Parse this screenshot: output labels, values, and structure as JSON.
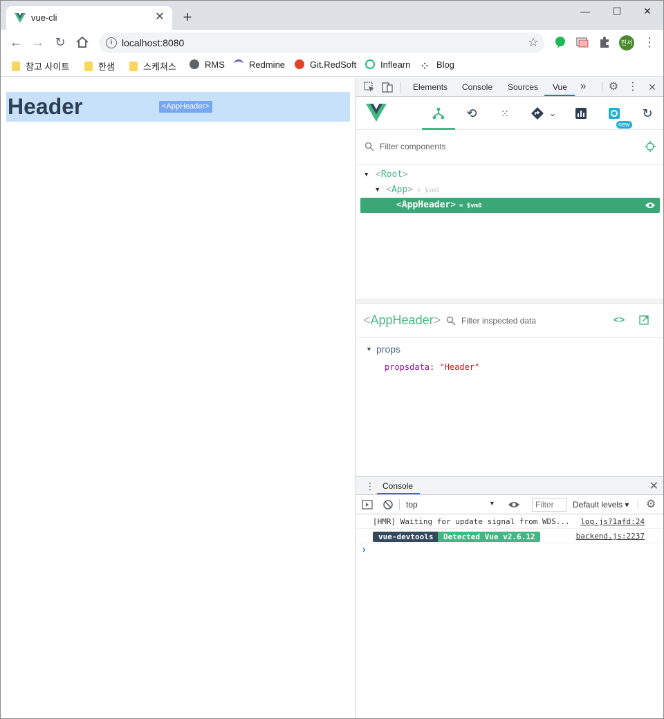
{
  "browser": {
    "tab_title": "vue-cli",
    "new_tab_glyph": "+",
    "url": "localhost:8080",
    "profile_label": "진서",
    "window_controls": {
      "minimize": "—",
      "maximize": "☐",
      "close": "✕"
    }
  },
  "bookmarks": [
    {
      "label": "참고 사이트",
      "icon": "folder-icon"
    },
    {
      "label": "한샘",
      "icon": "folder-icon"
    },
    {
      "label": "스케쳐스",
      "icon": "folder-icon"
    },
    {
      "label": "RMS",
      "icon": "globe-icon"
    },
    {
      "label": "Redmine",
      "icon": "redmine-icon"
    },
    {
      "label": "Git.RedSoft",
      "icon": "gitlab-icon"
    },
    {
      "label": "Inflearn",
      "icon": "inflearn-icon"
    },
    {
      "label": "Blog",
      "icon": "blog-icon"
    }
  ],
  "page": {
    "header_text": "Header",
    "component_tag": "<AppHeader>"
  },
  "devtools": {
    "tabs": [
      "Elements",
      "Console",
      "Sources",
      "Vue"
    ],
    "more_tabs_glyph": "»",
    "active_tab": "Vue",
    "vue": {
      "filter_placeholder": "Filter components",
      "new_badge": "new",
      "tree": [
        {
          "name": "Root",
          "vm": ""
        },
        {
          "name": "App",
          "vm": "= $vm1"
        },
        {
          "name": "AppHeader",
          "vm": "= $vm0"
        }
      ],
      "inspector": {
        "component_name": "AppHeader",
        "filter_placeholder": "Filter inspected data",
        "code_glyph": "<>",
        "section_label": "props",
        "prop_key": "propsdata",
        "prop_value": "\"Header\""
      }
    },
    "console": {
      "drawer_tab": "Console",
      "context": "top",
      "filter_placeholder": "Filter",
      "levels": "Default levels ▾",
      "messages": [
        {
          "text": "[HMR] Waiting for update signal from WDS...",
          "source": "log.js?1afd:24"
        },
        {
          "badge_left": "vue-devtools",
          "badge_right": "Detected Vue v2.6.12",
          "source": "backend.js:2237"
        }
      ],
      "prompt": "›"
    }
  },
  "colors": {
    "vue_green": "#42b983",
    "selected_row": "#3ba776",
    "header_bg": "#c7e1fb",
    "header_text": "#2c3e50"
  }
}
